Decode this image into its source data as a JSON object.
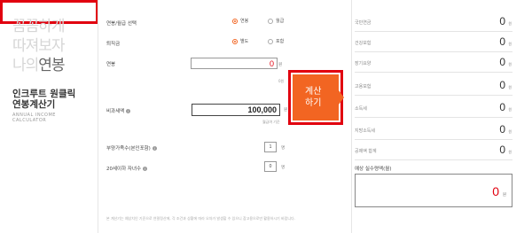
{
  "brand": {
    "line1": "꼼꼼하게",
    "line2": "따져보자",
    "line3_light": "나의",
    "line3_dark": "연봉",
    "title1": "인크루트 원클릭",
    "title2": "연봉계산기",
    "eng1": "ANNUAL INCOME",
    "eng2": "CALCULATOR",
    "eng3": ""
  },
  "form": {
    "salary_type_label": "연봉/월급 선택",
    "salary_type_options": [
      "연봉",
      "월급"
    ],
    "severance_label": "퇴직금",
    "severance_options": [
      "별도",
      "포함"
    ],
    "salary_label": "연봉",
    "salary_value": "0",
    "salary_unit": "원",
    "salary_note": "0원",
    "nontax_label": "비과세액",
    "nontax_value": "100,000",
    "nontax_unit": "원",
    "nontax_note": "월급여 기준",
    "dependents_label": "부양가족수(본인포함)",
    "dependents_value": "1",
    "dependents_unit": "명",
    "children_label": "20세이하 자녀수",
    "children_value": "0",
    "children_unit": "명",
    "calc_button_line1": "계산",
    "calc_button_line2": "하기",
    "footnote": "본 계산기는 예상치인 기준으로 연말정산에, 각 조건과 상황에 따라 오차가 발생할 수 있으니 참고용으로만 활용하시기 바랍니다."
  },
  "results": {
    "rows": [
      {
        "label": "국민연금",
        "value": "0",
        "unit": "원"
      },
      {
        "label": "건강보험",
        "value": "0",
        "unit": "원"
      },
      {
        "label": "장기요양",
        "value": "0",
        "unit": "원"
      },
      {
        "label": "고용보험",
        "value": "0",
        "unit": "원"
      },
      {
        "label": "소득세",
        "value": "0",
        "unit": "원"
      },
      {
        "label": "지방소득세",
        "value": "0",
        "unit": "원"
      },
      {
        "label": "공제액 합계",
        "value": "0",
        "unit": "원"
      }
    ],
    "final_label": "예상 실수령액(월)",
    "final_value": "0",
    "final_unit": "원"
  },
  "colors": {
    "accent": "#f26522",
    "highlight": "#e1000f"
  }
}
